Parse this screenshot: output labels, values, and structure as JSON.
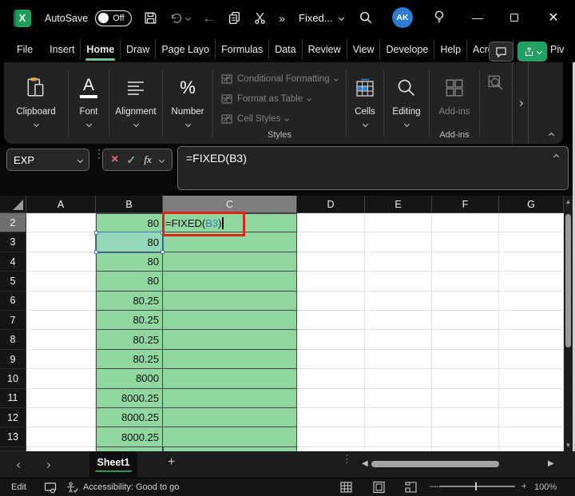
{
  "titlebar": {
    "autosave_label": "AutoSave",
    "autosave_state": "Off",
    "overflow": "»",
    "doc_title": "Fixed...",
    "avatar_initials": "AK"
  },
  "menu_tabs": {
    "items": [
      "File",
      "Insert",
      "Home",
      "Draw",
      "Page Layo",
      "Formulas",
      "Data",
      "Review",
      "View",
      "Develope",
      "Help",
      "Acrobat",
      "Power Piv"
    ],
    "active": "Home"
  },
  "ribbon": {
    "groups": [
      {
        "label": "Clipboard",
        "icon": "clipboard-icon"
      },
      {
        "label": "Font",
        "icon": "font-icon"
      },
      {
        "label": "Alignment",
        "icon": "alignment-icon"
      },
      {
        "label": "Number",
        "icon": "percent-icon"
      }
    ],
    "styles": {
      "items": [
        "Conditional Formatting",
        "Format as Table",
        "Cell Styles"
      ],
      "caption": "Styles"
    },
    "cells_label": "Cells",
    "editing_label": "Editing",
    "addins_label": "Add-ins",
    "addins_caption": "Add-ins"
  },
  "formula_bar": {
    "name_box_value": "EXP",
    "formula": "=FIXED(B3)",
    "fx_label": "fx",
    "cancel_glyph": "×",
    "enter_glyph": "✓"
  },
  "grid": {
    "columns": [
      "A",
      "B",
      "C",
      "D",
      "E",
      "F",
      "G"
    ],
    "active_column": "C",
    "active_row": 2,
    "rows": [
      {
        "n": 2,
        "b": "80"
      },
      {
        "n": 3,
        "b": "80"
      },
      {
        "n": 4,
        "b": "80"
      },
      {
        "n": 5,
        "b": "80"
      },
      {
        "n": 6,
        "b": "80.25"
      },
      {
        "n": 7,
        "b": "80.25"
      },
      {
        "n": 8,
        "b": "80.25"
      },
      {
        "n": 9,
        "b": "80.25"
      },
      {
        "n": 10,
        "b": "8000"
      },
      {
        "n": 11,
        "b": "8000.25"
      },
      {
        "n": 12,
        "b": "8000.25"
      },
      {
        "n": 13,
        "b": "8000.25"
      }
    ],
    "edit_cell": {
      "row": 2,
      "col": "C",
      "prefix": "=FIXED(",
      "ref": "B3",
      "suffix": ")"
    },
    "ref_cell": {
      "row": 3,
      "col": "B"
    }
  },
  "sheet_bar": {
    "active_tab": "Sheet1",
    "add_label": "+"
  },
  "status_bar": {
    "mode": "Edit",
    "accessibility": "Accessibility: Good to go",
    "zoom_level": "100%"
  },
  "colors": {
    "accent_green": "#23a164",
    "tab_underline_green": "#6fc493",
    "sheet_underline_green": "#1f9d5a",
    "cell_fill_green": "#8fd69f",
    "ref_fill_green": "#92d8b9",
    "ref_border_blue": "#4a7ebb",
    "annotation_red": "#e0241b",
    "formula_ref_blue": "#3f7fc1",
    "avatar_blue": "#2b7cd3"
  }
}
